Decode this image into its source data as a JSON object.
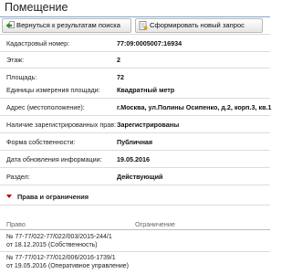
{
  "header": {
    "title": "Помещение"
  },
  "toolbar": {
    "back_label": "Вернуться к результатам поиска",
    "back_icon": "back-arrow-icon",
    "new_request_label": "Сформировать новый запрос",
    "new_request_icon": "document-icon"
  },
  "fields": [
    {
      "label": "Кадастровый номер:",
      "value": "77:09:0005007:16934"
    },
    {
      "label": "Этаж:",
      "value": "2"
    },
    {
      "label": "Площадь:",
      "value": "72"
    },
    {
      "label": "Единицы измерения площади:",
      "value": "Квадратный метр"
    },
    {
      "label": "Адрес (местоположение):",
      "value": "г.Москва, ул.Полины Осипенко, д.2, корп.3, кв.1"
    },
    {
      "label": "Наличие зарегистрированных прав:",
      "value": "Зарегистрированы"
    },
    {
      "label": "Форма собственности:",
      "value": "Публичная"
    },
    {
      "label": "Дата обновления информации:",
      "value": "19.05.2016"
    },
    {
      "label": "Раздел:",
      "value": "Действующий"
    }
  ],
  "rights_section": {
    "title": "Права и ограничения",
    "columns": [
      "Право",
      "Ограничение"
    ],
    "rows": [
      {
        "right_line1": "№ 77-77/022-77/022/003/2015-244/1",
        "right_line2": "от 18.12.2015  (Собственность)",
        "restriction": ""
      },
      {
        "right_line1": "№ 77-77/012-77/012/006/2016-1739/1",
        "right_line2": "от 19.05.2016  (Оперативное управление)",
        "restriction": ""
      }
    ]
  }
}
